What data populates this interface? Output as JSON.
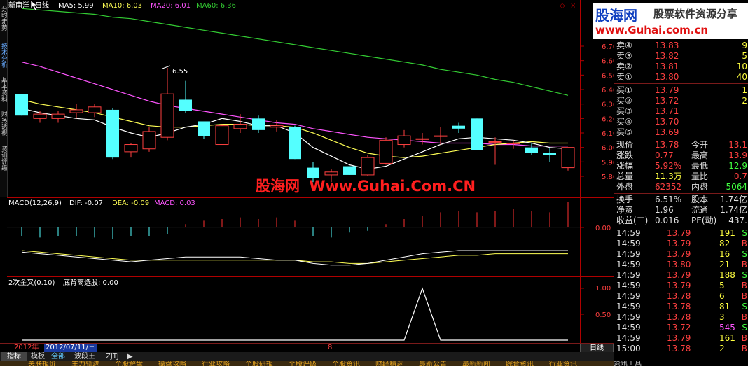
{
  "header": {
    "stock_name": "新南洋",
    "period": "日线",
    "ma5": "MA5: 5.99",
    "ma10": "MA10: 6.03",
    "ma20": "MA20: 6.01",
    "ma60": "MA60: 6.36"
  },
  "left_tabs": [
    "分时走势",
    "技术分析",
    "基本资料",
    "财务透视",
    "资讯评级"
  ],
  "price_axis": [
    "6.70",
    "6.60",
    "6.50",
    "6.40",
    "6.30",
    "6.20",
    "6.10",
    "6.00",
    "5.90",
    "5.80"
  ],
  "high_marker": "6.55",
  "macd": {
    "label": "MACD(12,26,9)",
    "dif": "DIF: -0.07",
    "dea": "DEA: -0.09",
    "macd": "MACD: 0.03",
    "axis": "0.00"
  },
  "indicator": {
    "label": "2次金叉(0.10)",
    "value": "底背离选股: 0.00",
    "axis": [
      "1.00",
      "0.50"
    ]
  },
  "watermark_center": {
    "part1": "股海网",
    "part2": "Www.Guhai.Com.CN"
  },
  "watermark_corner": {
    "logo": "股海网",
    "slogan": "股票软件资源分享",
    "url": "www.Guhai.com.cn"
  },
  "bottom_bar": {
    "year": "2012年",
    "date": "2012/07/11/三",
    "marker": "8",
    "period_button": "日线"
  },
  "bottom_tabs": [
    "指标",
    "模板",
    "全部",
    "波段王",
    "ZJTJ"
  ],
  "sub_tabs": [
    "关联报价",
    "主力轨迹",
    "个股解盘",
    "操盘攻略",
    "行业攻略",
    "个股研报",
    "个股评级",
    "个股资讯",
    "财经精选",
    "最新公告",
    "最新新闻",
    "综合资讯",
    "行业资讯"
  ],
  "sub_tabs_right": "资讯工具",
  "ask": [
    {
      "label": "卖④",
      "price": "13.83",
      "vol": "9"
    },
    {
      "label": "卖③",
      "price": "13.82",
      "vol": "5"
    },
    {
      "label": "卖②",
      "price": "13.81",
      "vol": "10"
    },
    {
      "label": "卖①",
      "price": "13.80",
      "vol": "40"
    }
  ],
  "bid": [
    {
      "label": "买①",
      "price": "13.79",
      "vol": "1"
    },
    {
      "label": "买②",
      "price": "13.72",
      "vol": "2"
    },
    {
      "label": "买③",
      "price": "13.71",
      "vol": ""
    },
    {
      "label": "买④",
      "price": "13.70",
      "vol": ""
    },
    {
      "label": "买⑤",
      "price": "13.69",
      "vol": ""
    }
  ],
  "stats": [
    {
      "l1": "现价",
      "v1": "13.78",
      "l2": "今开",
      "v2": "13.1"
    },
    {
      "l1": "涨跌",
      "v1": "0.77",
      "l2": "最高",
      "v2": "13.9"
    },
    {
      "l1": "涨幅",
      "v1": "5.92%",
      "l2": "最低",
      "v2": "12.9"
    },
    {
      "l1": "总量",
      "v1": "11.3万",
      "l2": "量比",
      "v2": "0.7"
    },
    {
      "l1": "外盘",
      "v1": "62352",
      "l2": "内盘",
      "v2": "5064"
    }
  ],
  "stats2": [
    {
      "l1": "换手",
      "v1": "6.51%",
      "l2": "股本",
      "v2": "1.74亿"
    },
    {
      "l1": "净资",
      "v1": "1.96",
      "l2": "流通",
      "v2": "1.74亿"
    },
    {
      "l1": "收益(二)",
      "v1": "0.016",
      "l2": "PE(动)",
      "v2": "437."
    }
  ],
  "ticks": [
    {
      "time": "14:59",
      "price": "13.79",
      "vol": "191",
      "flag": "S"
    },
    {
      "time": "14:59",
      "price": "13.79",
      "vol": "82",
      "flag": "B"
    },
    {
      "time": "14:59",
      "price": "13.79",
      "vol": "16",
      "flag": "S"
    },
    {
      "time": "14:59",
      "price": "13.80",
      "vol": "21",
      "flag": "B"
    },
    {
      "time": "14:59",
      "price": "13.79",
      "vol": "188",
      "flag": "S"
    },
    {
      "time": "14:59",
      "price": "13.79",
      "vol": "5",
      "flag": "B"
    },
    {
      "time": "14:59",
      "price": "13.78",
      "vol": "6",
      "flag": "B"
    },
    {
      "time": "14:59",
      "price": "13.78",
      "vol": "81",
      "flag": "S"
    },
    {
      "time": "14:59",
      "price": "13.78",
      "vol": "3",
      "flag": "B"
    },
    {
      "time": "14:59",
      "price": "13.72",
      "vol": "545",
      "flag": "S"
    },
    {
      "time": "14:59",
      "price": "13.79",
      "vol": "161",
      "flag": "B"
    },
    {
      "time": "15:00",
      "price": "13.78",
      "vol": "2",
      "flag": "B"
    }
  ],
  "colors": {
    "up": "#ff4040",
    "down": "#54ffff",
    "ma5": "#ffffff",
    "ma10": "#ffff55",
    "ma20": "#ff55ff",
    "ma60": "#33cc33",
    "axis": "#b00000",
    "macd_pos": "#ff3030",
    "macd_neg": "#54ffff"
  },
  "chart_data": {
    "type": "candlestick",
    "candles": [
      {
        "o": 6.37,
        "h": 6.37,
        "l": 6.22,
        "c": 6.22
      },
      {
        "o": 6.2,
        "h": 6.25,
        "l": 6.17,
        "c": 6.23
      },
      {
        "o": 6.2,
        "h": 6.25,
        "l": 6.17,
        "c": 6.23
      },
      {
        "o": 6.24,
        "h": 6.3,
        "l": 6.2,
        "c": 6.26
      },
      {
        "o": 6.24,
        "h": 6.3,
        "l": 6.21,
        "c": 6.28
      },
      {
        "o": 6.26,
        "h": 6.27,
        "l": 5.92,
        "c": 5.93
      },
      {
        "o": 5.97,
        "h": 6.03,
        "l": 5.93,
        "c": 6.02
      },
      {
        "o": 5.99,
        "h": 6.14,
        "l": 5.97,
        "c": 6.11
      },
      {
        "o": 6.07,
        "h": 6.55,
        "l": 6.05,
        "c": 6.37
      },
      {
        "o": 6.33,
        "h": 6.46,
        "l": 6.24,
        "c": 6.25
      },
      {
        "o": 6.18,
        "h": 6.18,
        "l": 6.06,
        "c": 6.08
      },
      {
        "o": 6.02,
        "h": 6.16,
        "l": 6.02,
        "c": 6.15
      },
      {
        "o": 6.13,
        "h": 6.23,
        "l": 6.1,
        "c": 6.16
      },
      {
        "o": 6.2,
        "h": 6.22,
        "l": 6.1,
        "c": 6.12
      },
      {
        "o": 6.14,
        "h": 6.19,
        "l": 6.11,
        "c": 6.15
      },
      {
        "o": 6.14,
        "h": 6.15,
        "l": 5.92,
        "c": 5.92
      },
      {
        "o": 5.86,
        "h": 5.9,
        "l": 5.76,
        "c": 5.79
      },
      {
        "o": 5.81,
        "h": 5.85,
        "l": 5.76,
        "c": 5.83
      },
      {
        "o": 5.87,
        "h": 5.87,
        "l": 5.81,
        "c": 5.81
      },
      {
        "o": 5.81,
        "h": 5.95,
        "l": 5.8,
        "c": 5.93
      },
      {
        "o": 5.89,
        "h": 6.07,
        "l": 5.88,
        "c": 6.05
      },
      {
        "o": 6.02,
        "h": 6.12,
        "l": 6.0,
        "c": 6.08
      },
      {
        "o": 6.06,
        "h": 6.1,
        "l": 6.02,
        "c": 6.06
      },
      {
        "o": 6.08,
        "h": 6.14,
        "l": 6.02,
        "c": 6.08
      },
      {
        "o": 6.15,
        "h": 6.17,
        "l": 6.1,
        "c": 6.13
      },
      {
        "o": 6.2,
        "h": 6.2,
        "l": 5.98,
        "c": 5.98
      },
      {
        "o": 6.04,
        "h": 6.07,
        "l": 5.88,
        "c": 6.04
      },
      {
        "o": 6.03,
        "h": 6.05,
        "l": 5.99,
        "c": 6.03
      },
      {
        "o": 6.0,
        "h": 6.03,
        "l": 5.95,
        "c": 5.96
      },
      {
        "o": 5.96,
        "h": 6.0,
        "l": 5.9,
        "c": 5.95
      },
      {
        "o": 5.86,
        "h": 6.0,
        "l": 5.84,
        "c": 6.0
      }
    ],
    "ma5": [
      6.27,
      6.24,
      6.22,
      6.2,
      6.19,
      6.14,
      6.1,
      6.07,
      6.1,
      6.14,
      6.16,
      6.2,
      6.18,
      6.15,
      6.15,
      6.1,
      6.0,
      5.94,
      5.88,
      5.85,
      5.87,
      5.92,
      5.97,
      6.02,
      6.06,
      6.07,
      6.06,
      6.05,
      6.03,
      6.0,
      5.99
    ],
    "ma10": [
      6.33,
      6.3,
      6.28,
      6.26,
      6.24,
      6.21,
      6.18,
      6.15,
      6.14,
      6.14,
      6.15,
      6.16,
      6.16,
      6.15,
      6.15,
      6.14,
      6.1,
      6.05,
      6.0,
      5.96,
      5.94,
      5.93,
      5.94,
      5.96,
      5.98,
      6.0,
      6.02,
      6.03,
      6.04,
      6.03,
      6.03
    ],
    "ma20": [
      6.59,
      6.56,
      6.52,
      6.48,
      6.44,
      6.4,
      6.36,
      6.32,
      6.29,
      6.27,
      6.25,
      6.23,
      6.21,
      6.19,
      6.17,
      6.16,
      6.13,
      6.11,
      6.09,
      6.07,
      6.06,
      6.05,
      6.04,
      6.03,
      6.03,
      6.03,
      6.02,
      6.02,
      6.01,
      6.01,
      6.01
    ],
    "ma60": [
      6.96,
      6.95,
      6.94,
      6.93,
      6.92,
      6.9,
      6.89,
      6.87,
      6.85,
      6.83,
      6.81,
      6.79,
      6.77,
      6.75,
      6.73,
      6.71,
      6.69,
      6.67,
      6.65,
      6.63,
      6.61,
      6.59,
      6.57,
      6.54,
      6.52,
      6.5,
      6.47,
      6.45,
      6.42,
      6.39,
      6.36
    ],
    "ylim": [
      5.76,
      6.76
    ],
    "macd_hist": [
      -0.01,
      -0.012,
      -0.01,
      -0.01,
      -0.012,
      -0.014,
      -0.01,
      -0.01,
      -0.008,
      0.004,
      0.008,
      0.01,
      0.012,
      0.01,
      0.012,
      0.008,
      -0.01,
      -0.012,
      -0.006,
      -0.004,
      0.004,
      0.01,
      0.014,
      0.018,
      0.02,
      0.018,
      0.02,
      0.022,
      0.02,
      0.018,
      0.03
    ],
    "dif": [
      -0.08,
      -0.09,
      -0.1,
      -0.11,
      -0.12,
      -0.13,
      -0.14,
      -0.13,
      -0.12,
      -0.11,
      -0.11,
      -0.11,
      -0.11,
      -0.12,
      -0.13,
      -0.13,
      -0.15,
      -0.16,
      -0.16,
      -0.15,
      -0.13,
      -0.11,
      -0.09,
      -0.08,
      -0.07,
      -0.07,
      -0.07,
      -0.07,
      -0.07,
      -0.07,
      -0.07
    ],
    "dea": [
      -0.07,
      -0.08,
      -0.09,
      -0.1,
      -0.11,
      -0.12,
      -0.13,
      -0.13,
      -0.13,
      -0.13,
      -0.13,
      -0.13,
      -0.13,
      -0.13,
      -0.13,
      -0.13,
      -0.14,
      -0.14,
      -0.15,
      -0.15,
      -0.14,
      -0.13,
      -0.12,
      -0.11,
      -0.1,
      -0.1,
      -0.09,
      -0.09,
      -0.09,
      -0.09,
      -0.09
    ],
    "macd_ylim": [
      -0.2,
      0.06
    ],
    "signal": [
      0,
      0,
      0,
      0,
      0,
      0,
      0,
      0,
      0,
      0,
      0,
      0,
      0,
      0,
      0,
      0,
      0,
      0,
      0,
      0,
      0,
      0,
      1,
      0,
      0,
      0,
      0,
      0,
      0,
      0,
      0
    ],
    "signal_ylim": [
      0,
      1.2
    ]
  }
}
